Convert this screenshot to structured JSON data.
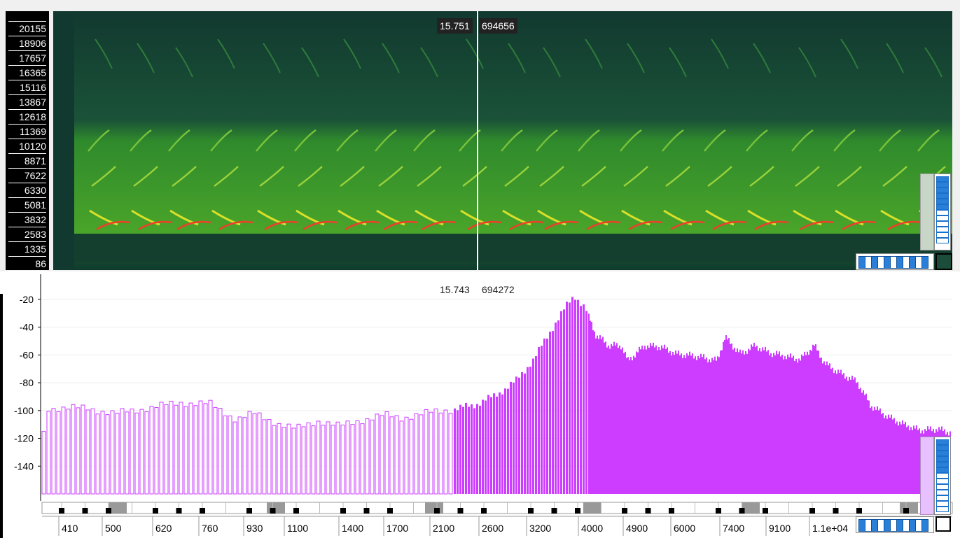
{
  "spectrogram": {
    "freq_ticks": [
      "20155",
      "18906",
      "17657",
      "16365",
      "15116",
      "13867",
      "12618",
      "11369",
      "10120",
      "8871",
      "7622",
      "6330",
      "5081",
      "3832",
      "2583",
      "1335",
      "86"
    ],
    "cursor_time": "15.751",
    "cursor_value": "694656"
  },
  "spectrum": {
    "cursor_time": "15.743",
    "cursor_value": "694272"
  },
  "chart_data": [
    {
      "type": "heatmap",
      "title": "",
      "y_ticks": [
        20155,
        18906,
        17657,
        16365,
        15116,
        13867,
        12618,
        11369,
        10120,
        8871,
        7622,
        6330,
        5081,
        3832,
        2583,
        1335,
        86
      ],
      "colors": {
        "background": "#0f3d33",
        "mid": "#3b9d28",
        "high": "#d8e22a",
        "peak": "#e8422a"
      }
    },
    {
      "type": "bar",
      "title": "",
      "ylabel": "",
      "xlabel": "",
      "ylim": [
        -160,
        -12
      ],
      "y_ticks": [
        -20,
        -40,
        -60,
        -80,
        -100,
        -120,
        -140
      ],
      "x_ticks": [
        "410",
        "500",
        "620",
        "760",
        "930",
        "1100",
        "1400",
        "1700",
        "2100",
        "2600",
        "3200",
        "4000",
        "4900",
        "6000",
        "7400",
        "9100",
        "1.1e+04"
      ],
      "x_scale": "log",
      "color": "#cc3dff",
      "envelope": [
        {
          "x": 350,
          "y": -97
        },
        {
          "x": 420,
          "y": -97
        },
        {
          "x": 470,
          "y": -101
        },
        {
          "x": 520,
          "y": -98
        },
        {
          "x": 620,
          "y": -93
        },
        {
          "x": 700,
          "y": -94
        },
        {
          "x": 780,
          "y": -105
        },
        {
          "x": 840,
          "y": -101
        },
        {
          "x": 930,
          "y": -108
        },
        {
          "x": 1000,
          "y": -112
        },
        {
          "x": 1100,
          "y": -106
        },
        {
          "x": 1200,
          "y": -110
        },
        {
          "x": 1300,
          "y": -106
        },
        {
          "x": 1450,
          "y": -102
        },
        {
          "x": 1550,
          "y": -104
        },
        {
          "x": 1700,
          "y": -101
        },
        {
          "x": 1900,
          "y": -98
        },
        {
          "x": 2100,
          "y": -95
        },
        {
          "x": 2300,
          "y": -88
        },
        {
          "x": 2500,
          "y": -78
        },
        {
          "x": 2700,
          "y": -62
        },
        {
          "x": 2900,
          "y": -41
        },
        {
          "x": 3100,
          "y": -23
        },
        {
          "x": 3200,
          "y": -16
        },
        {
          "x": 3350,
          "y": -25
        },
        {
          "x": 3500,
          "y": -44
        },
        {
          "x": 3700,
          "y": -52
        },
        {
          "x": 3900,
          "y": -52
        },
        {
          "x": 4000,
          "y": -63
        },
        {
          "x": 4300,
          "y": -52
        },
        {
          "x": 4600,
          "y": -53
        },
        {
          "x": 4900,
          "y": -58
        },
        {
          "x": 5400,
          "y": -60
        },
        {
          "x": 5800,
          "y": -63
        },
        {
          "x": 6000,
          "y": -46
        },
        {
          "x": 6400,
          "y": -58
        },
        {
          "x": 6800,
          "y": -52
        },
        {
          "x": 7200,
          "y": -57
        },
        {
          "x": 7600,
          "y": -59
        },
        {
          "x": 8200,
          "y": -62
        },
        {
          "x": 8700,
          "y": -52
        },
        {
          "x": 9100,
          "y": -65
        },
        {
          "x": 9700,
          "y": -72
        },
        {
          "x": 10400,
          "y": -78
        },
        {
          "x": 11000,
          "y": -95
        },
        {
          "x": 11800,
          "y": -103
        },
        {
          "x": 12500,
          "y": -108
        },
        {
          "x": 13500,
          "y": -113
        },
        {
          "x": 14500,
          "y": -112
        },
        {
          "x": 15500,
          "y": -115
        }
      ]
    }
  ]
}
